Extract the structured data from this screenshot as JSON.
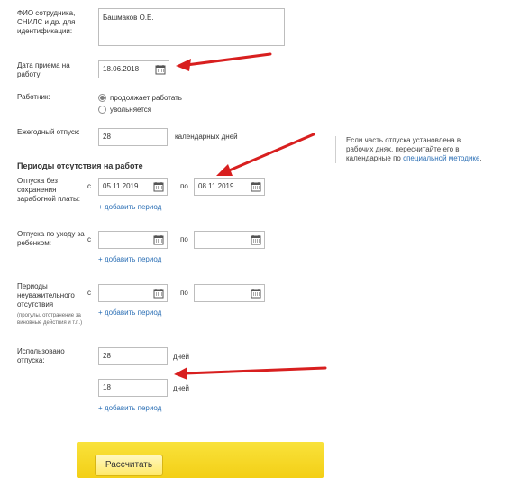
{
  "form": {
    "employee_label": "ФИО сотрудника, СНИЛС и др. для идентификации:",
    "employee_value": "Башмаков О.Е.",
    "hire_date_label": "Дата приема на работу:",
    "hire_date_value": "18.06.2018",
    "worker_label": "Работник:",
    "worker_options": {
      "continues": "продолжает работать",
      "leaving": "увольняется"
    },
    "annual_leave_label": "Ежегодный отпуск:",
    "annual_leave_value": "28",
    "annual_leave_unit": "календарных дней",
    "hint_text": "Если часть отпуска установлена в рабочих днях, пересчитайте его в календарные по ",
    "hint_link": "специальной методике",
    "hint_end": ".",
    "absence_title": "Периоды отсутствия на работе",
    "unpaid_label": "Отпуска без сохранения заработной платы:",
    "from": "с",
    "to": "по",
    "unpaid_from": "05.11.2019",
    "unpaid_to": "08.11.2019",
    "add_period": "+ добавить период",
    "childcare_label": "Отпуска по уходу за ребенком:",
    "absence_label": "Периоды неуважительного отсутствия",
    "absence_note": "(прогулы, отстранение за виновные действия и т.п.)",
    "used_label": "Использовано отпуска:",
    "used_value_1": "28",
    "used_value_2": "18",
    "days": "дней",
    "calculate_button": "Рассчитать"
  },
  "colors": {
    "link": "#2b6fb5",
    "arrow": "#d81f1f",
    "button_panel": "#f5d21f"
  },
  "icons": [
    "calendar-icon",
    "radio-button-icon",
    "red-arrow-icon"
  ]
}
